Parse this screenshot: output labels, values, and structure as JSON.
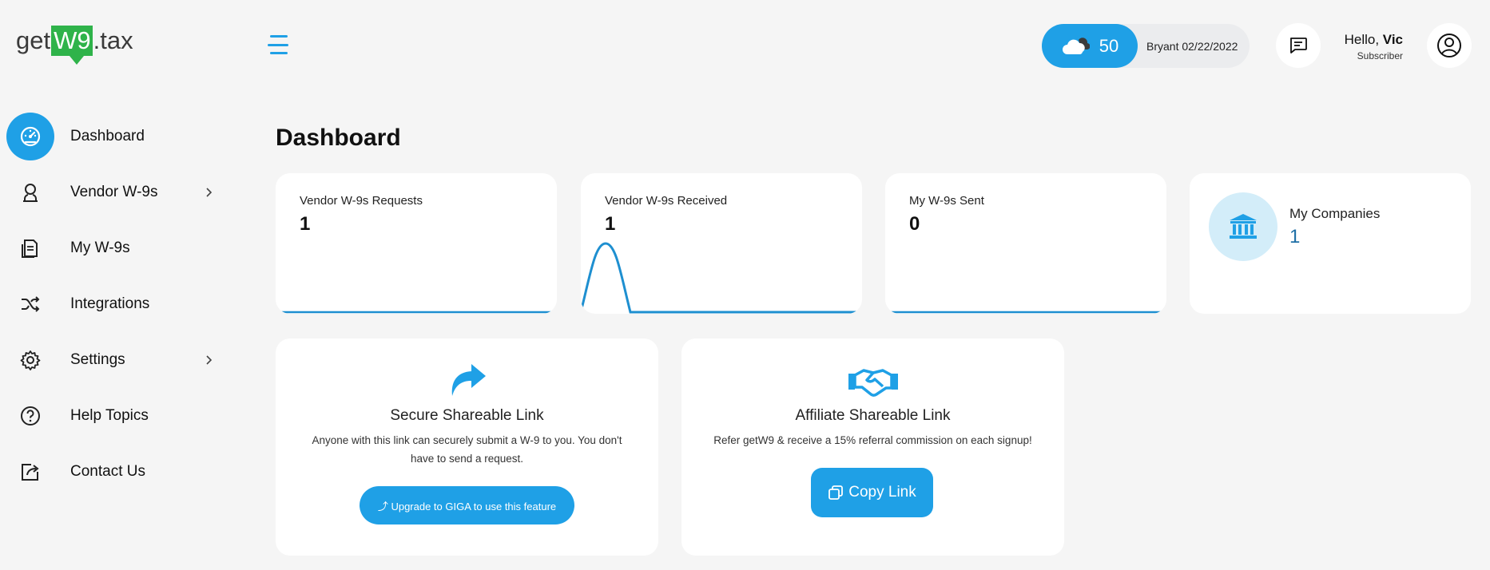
{
  "brand": {
    "prefix": "get",
    "highlight": "W9",
    "suffix": ".tax"
  },
  "header": {
    "weather": {
      "temperature": "50",
      "icon": "cloud-icon",
      "label": "Bryant 02/22/2022"
    },
    "greeting": "Hello, ",
    "user_name": "Vic",
    "user_role": "Subscriber"
  },
  "sidebar": {
    "items": [
      {
        "label": "Dashboard",
        "icon": "dashboard-icon",
        "active": true
      },
      {
        "label": "Vendor W-9s",
        "icon": "vendor-icon",
        "has_submenu": true
      },
      {
        "label": "My W-9s",
        "icon": "document-icon"
      },
      {
        "label": "Integrations",
        "icon": "shuffle-icon"
      },
      {
        "label": "Settings",
        "icon": "gear-icon",
        "has_submenu": true
      },
      {
        "label": "Help Topics",
        "icon": "help-icon"
      },
      {
        "label": "Contact Us",
        "icon": "contact-icon"
      }
    ]
  },
  "main": {
    "title": "Dashboard",
    "stats": [
      {
        "label": "Vendor W-9s Requests",
        "value": "1"
      },
      {
        "label": "Vendor W-9s Received",
        "value": "1"
      },
      {
        "label": "My W-9s Sent",
        "value": "0"
      }
    ],
    "companies": {
      "label": "My Companies",
      "value": "1",
      "icon": "bank-icon"
    },
    "secure_link": {
      "title": "Secure Shareable Link",
      "description": "Anyone with this link can securely submit a W-9 to you. You don't have to send a request.",
      "button": "⤴ Upgrade to GIGA to use this feature",
      "icon": "share-arrow-icon"
    },
    "affiliate_link": {
      "title": "Affiliate Shareable Link",
      "description": "Refer getW9 & receive a 15% referral commission on each signup!",
      "button": "Copy Link",
      "icon": "handshake-icon"
    }
  },
  "colors": {
    "accent": "#1fa0e6",
    "brand_green": "#2fb34a",
    "background": "#f5f5f5",
    "card": "#ffffff",
    "icon_circle": "#d3edf9"
  }
}
